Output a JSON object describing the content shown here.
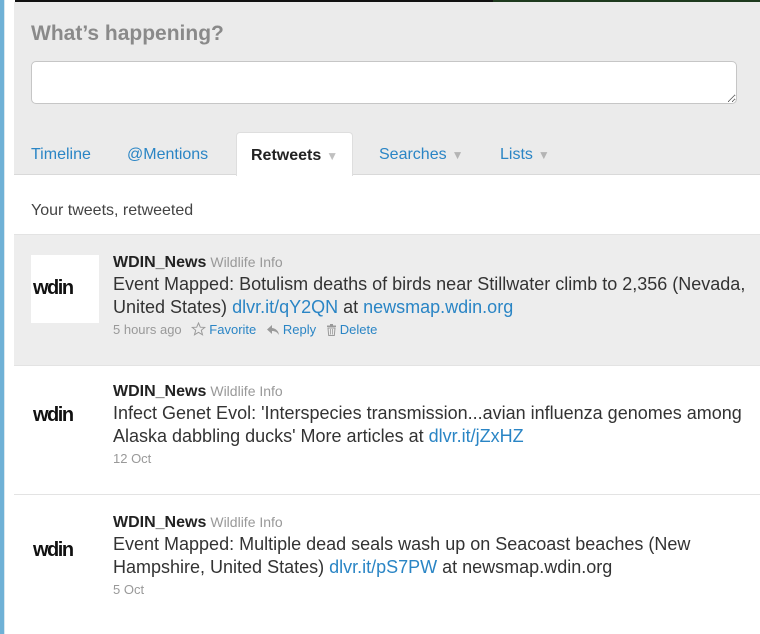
{
  "compose": {
    "title": "What’s happening?",
    "input_value": ""
  },
  "tabs": [
    {
      "label": "Timeline",
      "has_caret": false,
      "active": false
    },
    {
      "label": "@Mentions",
      "has_caret": false,
      "active": false
    },
    {
      "label": "Retweets",
      "has_caret": true,
      "active": true
    },
    {
      "label": "Searches",
      "has_caret": true,
      "active": false
    },
    {
      "label": "Lists",
      "has_caret": true,
      "active": false
    }
  ],
  "caret_glyph": "▼",
  "section_heading": "Your tweets, retweeted",
  "avatar_logo": "wdin",
  "tweets": [
    {
      "screen_name": "WDIN_News",
      "full_name": "Wildlife Info",
      "text_parts": [
        "Event Mapped: Botulism deaths of birds near Stillwater climb to 2,356 (Nevada, United States) ",
        "dlvr.it/qY2QN",
        " at ",
        "newsmap.wdin.org"
      ],
      "time": "5 hours ago",
      "actions": {
        "favorite": "Favorite",
        "reply": "Reply",
        "delete": "Delete"
      }
    },
    {
      "screen_name": "WDIN_News",
      "full_name": "Wildlife Info",
      "text_parts": [
        "Infect Genet Evol: 'Interspecies transmission...avian influenza genomes among Alaska dabbling ducks' More articles at ",
        "dlvr.it/jZxHZ"
      ],
      "time": "12 Oct"
    },
    {
      "screen_name": "WDIN_News",
      "full_name": "Wildlife Info",
      "text_parts": [
        "Event Mapped: Multiple dead seals wash up on Seacoast beaches (New Hampshire, United States) ",
        "dlvr.it/pS7PW",
        " at newsmap.wdin.org"
      ],
      "time": "5 Oct"
    }
  ],
  "colors": {
    "link": "#2a85c5",
    "panel_bg": "#ebebeb",
    "highlight_bg": "#ededed",
    "left_edge": "#6fb1d6"
  },
  "icons": [
    "star-icon",
    "reply-arrow-icon",
    "trash-icon",
    "caret-down-icon"
  ]
}
